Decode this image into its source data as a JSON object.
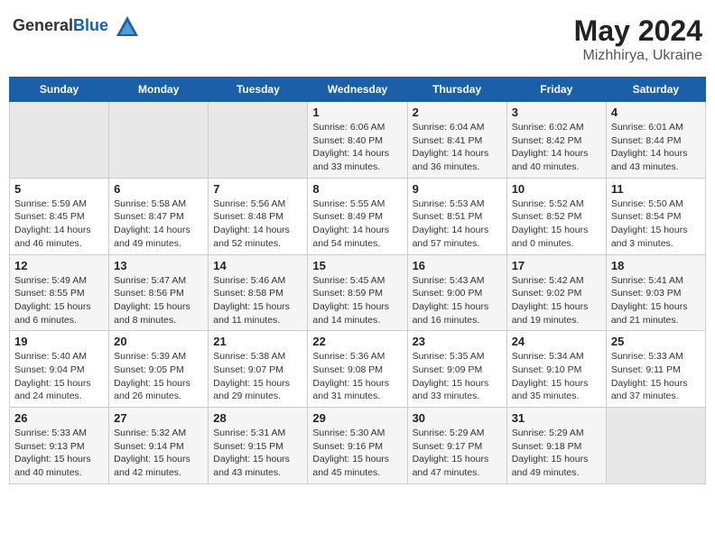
{
  "header": {
    "logo_general": "General",
    "logo_blue": "Blue",
    "title": "May 2024",
    "subtitle": "Mizhhirya, Ukraine"
  },
  "weekdays": [
    "Sunday",
    "Monday",
    "Tuesday",
    "Wednesday",
    "Thursday",
    "Friday",
    "Saturday"
  ],
  "weeks": [
    [
      {
        "day": "",
        "info": ""
      },
      {
        "day": "",
        "info": ""
      },
      {
        "day": "",
        "info": ""
      },
      {
        "day": "1",
        "info": "Sunrise: 6:06 AM\nSunset: 8:40 PM\nDaylight: 14 hours\nand 33 minutes."
      },
      {
        "day": "2",
        "info": "Sunrise: 6:04 AM\nSunset: 8:41 PM\nDaylight: 14 hours\nand 36 minutes."
      },
      {
        "day": "3",
        "info": "Sunrise: 6:02 AM\nSunset: 8:42 PM\nDaylight: 14 hours\nand 40 minutes."
      },
      {
        "day": "4",
        "info": "Sunrise: 6:01 AM\nSunset: 8:44 PM\nDaylight: 14 hours\nand 43 minutes."
      }
    ],
    [
      {
        "day": "5",
        "info": "Sunrise: 5:59 AM\nSunset: 8:45 PM\nDaylight: 14 hours\nand 46 minutes."
      },
      {
        "day": "6",
        "info": "Sunrise: 5:58 AM\nSunset: 8:47 PM\nDaylight: 14 hours\nand 49 minutes."
      },
      {
        "day": "7",
        "info": "Sunrise: 5:56 AM\nSunset: 8:48 PM\nDaylight: 14 hours\nand 52 minutes."
      },
      {
        "day": "8",
        "info": "Sunrise: 5:55 AM\nSunset: 8:49 PM\nDaylight: 14 hours\nand 54 minutes."
      },
      {
        "day": "9",
        "info": "Sunrise: 5:53 AM\nSunset: 8:51 PM\nDaylight: 14 hours\nand 57 minutes."
      },
      {
        "day": "10",
        "info": "Sunrise: 5:52 AM\nSunset: 8:52 PM\nDaylight: 15 hours\nand 0 minutes."
      },
      {
        "day": "11",
        "info": "Sunrise: 5:50 AM\nSunset: 8:54 PM\nDaylight: 15 hours\nand 3 minutes."
      }
    ],
    [
      {
        "day": "12",
        "info": "Sunrise: 5:49 AM\nSunset: 8:55 PM\nDaylight: 15 hours\nand 6 minutes."
      },
      {
        "day": "13",
        "info": "Sunrise: 5:47 AM\nSunset: 8:56 PM\nDaylight: 15 hours\nand 8 minutes."
      },
      {
        "day": "14",
        "info": "Sunrise: 5:46 AM\nSunset: 8:58 PM\nDaylight: 15 hours\nand 11 minutes."
      },
      {
        "day": "15",
        "info": "Sunrise: 5:45 AM\nSunset: 8:59 PM\nDaylight: 15 hours\nand 14 minutes."
      },
      {
        "day": "16",
        "info": "Sunrise: 5:43 AM\nSunset: 9:00 PM\nDaylight: 15 hours\nand 16 minutes."
      },
      {
        "day": "17",
        "info": "Sunrise: 5:42 AM\nSunset: 9:02 PM\nDaylight: 15 hours\nand 19 minutes."
      },
      {
        "day": "18",
        "info": "Sunrise: 5:41 AM\nSunset: 9:03 PM\nDaylight: 15 hours\nand 21 minutes."
      }
    ],
    [
      {
        "day": "19",
        "info": "Sunrise: 5:40 AM\nSunset: 9:04 PM\nDaylight: 15 hours\nand 24 minutes."
      },
      {
        "day": "20",
        "info": "Sunrise: 5:39 AM\nSunset: 9:05 PM\nDaylight: 15 hours\nand 26 minutes."
      },
      {
        "day": "21",
        "info": "Sunrise: 5:38 AM\nSunset: 9:07 PM\nDaylight: 15 hours\nand 29 minutes."
      },
      {
        "day": "22",
        "info": "Sunrise: 5:36 AM\nSunset: 9:08 PM\nDaylight: 15 hours\nand 31 minutes."
      },
      {
        "day": "23",
        "info": "Sunrise: 5:35 AM\nSunset: 9:09 PM\nDaylight: 15 hours\nand 33 minutes."
      },
      {
        "day": "24",
        "info": "Sunrise: 5:34 AM\nSunset: 9:10 PM\nDaylight: 15 hours\nand 35 minutes."
      },
      {
        "day": "25",
        "info": "Sunrise: 5:33 AM\nSunset: 9:11 PM\nDaylight: 15 hours\nand 37 minutes."
      }
    ],
    [
      {
        "day": "26",
        "info": "Sunrise: 5:33 AM\nSunset: 9:13 PM\nDaylight: 15 hours\nand 40 minutes."
      },
      {
        "day": "27",
        "info": "Sunrise: 5:32 AM\nSunset: 9:14 PM\nDaylight: 15 hours\nand 42 minutes."
      },
      {
        "day": "28",
        "info": "Sunrise: 5:31 AM\nSunset: 9:15 PM\nDaylight: 15 hours\nand 43 minutes."
      },
      {
        "day": "29",
        "info": "Sunrise: 5:30 AM\nSunset: 9:16 PM\nDaylight: 15 hours\nand 45 minutes."
      },
      {
        "day": "30",
        "info": "Sunrise: 5:29 AM\nSunset: 9:17 PM\nDaylight: 15 hours\nand 47 minutes."
      },
      {
        "day": "31",
        "info": "Sunrise: 5:29 AM\nSunset: 9:18 PM\nDaylight: 15 hours\nand 49 minutes."
      },
      {
        "day": "",
        "info": ""
      }
    ]
  ]
}
